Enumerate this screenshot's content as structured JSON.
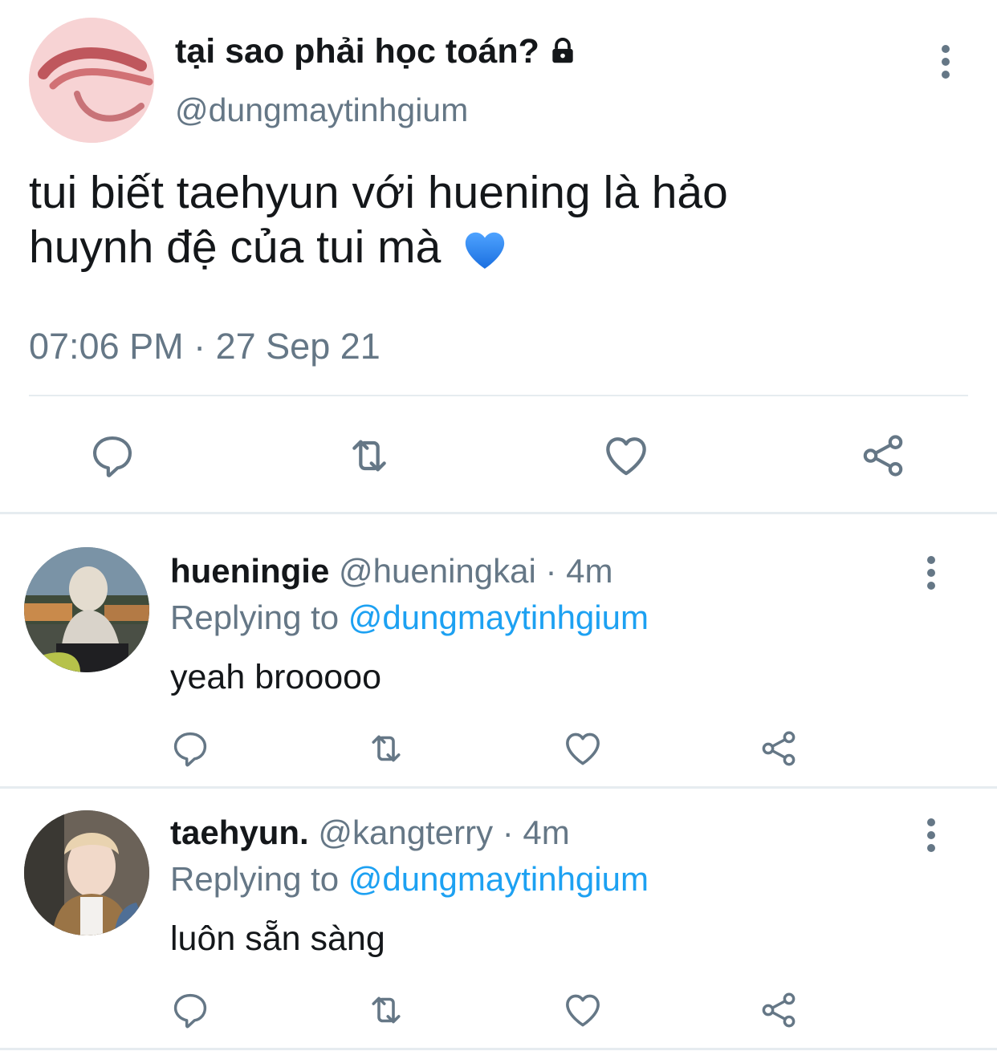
{
  "main_tweet": {
    "display_name": "tại sao phải học toán?",
    "handle": "@dungmaytinhgium",
    "text_line1": "tui biết taehyun với huening là hảo",
    "text_line2": "huynh đệ của tui mà",
    "emoji": "💙",
    "timestamp": "07:06 PM · 27 Sep 21",
    "protected_icon": "lock-icon"
  },
  "replies": [
    {
      "display_name": "hueningie",
      "handle": "@hueningkai",
      "time": "· 4m",
      "replying_prefix": "Replying to",
      "replying_handle": "@dungmaytinhgium",
      "text": "yeah brooooo"
    },
    {
      "display_name": "taehyun.",
      "handle": "@kangterry",
      "time": "· 4m",
      "replying_prefix": "Replying to",
      "replying_handle": "@dungmaytinhgium",
      "text": "luôn sẵn sàng"
    }
  ],
  "actions": [
    "reply-icon",
    "retweet-icon",
    "like-icon",
    "share-icon"
  ],
  "colors": {
    "text": "#14171a",
    "secondary": "#657786",
    "link": "#1da1f2",
    "divider": "#e6ecf0"
  }
}
